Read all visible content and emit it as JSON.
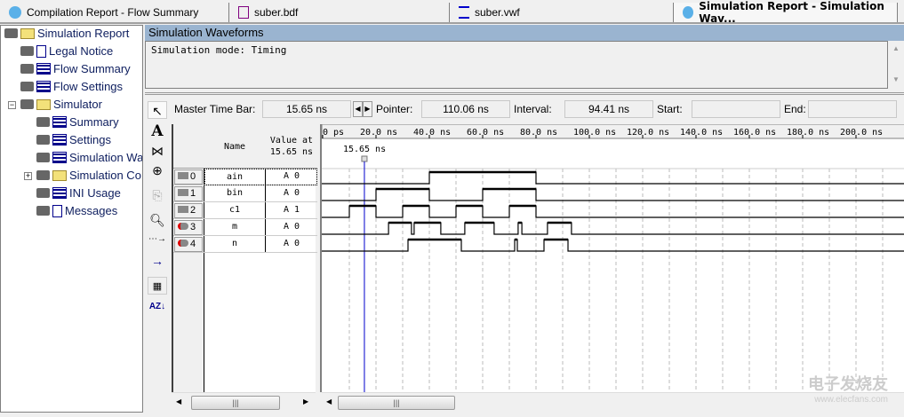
{
  "tabs": [
    {
      "label": "Compilation Report - Flow Summary",
      "icon": "report-icon",
      "active": false
    },
    {
      "label": "suber.bdf",
      "icon": "block-diagram-icon",
      "active": false
    },
    {
      "label": "suber.vwf",
      "icon": "waveform-file-icon",
      "active": false
    },
    {
      "label": "Simulation Report - Simulation Wav...",
      "icon": "report-icon",
      "active": true
    }
  ],
  "tree": [
    {
      "label": "Simulation Report",
      "icon": "folder-icon",
      "level": 0
    },
    {
      "label": "Legal Notice",
      "icon": "document-icon",
      "level": 1
    },
    {
      "label": "Flow Summary",
      "icon": "table-icon",
      "level": 1
    },
    {
      "label": "Flow Settings",
      "icon": "table-icon",
      "level": 1
    },
    {
      "label": "Simulator",
      "icon": "folder-icon",
      "level": 1,
      "expanded": true
    },
    {
      "label": "Summary",
      "icon": "table-icon",
      "level": 2
    },
    {
      "label": "Settings",
      "icon": "table-icon",
      "level": 2
    },
    {
      "label": "Simulation Wa",
      "icon": "waveform-icon",
      "level": 2
    },
    {
      "label": "Simulation Co",
      "icon": "folder-icon",
      "level": 2,
      "collapsed": true
    },
    {
      "label": "INI Usage",
      "icon": "table-icon",
      "level": 2
    },
    {
      "label": "Messages",
      "icon": "info-icon",
      "level": 2
    }
  ],
  "panel": {
    "title": "Simulation Waveforms",
    "mode_text": "Simulation mode: Timing"
  },
  "timebar": {
    "master_label": "Master Time Bar:",
    "master_value": "15.65 ns",
    "pointer_label": "Pointer:",
    "pointer_value": "110.06 ns",
    "interval_label": "Interval:",
    "interval_value": "94.41 ns",
    "start_label": "Start:",
    "start_value": "",
    "end_label": "End:",
    "end_value": ""
  },
  "table": {
    "name_header": "Name",
    "value_header": "Value at\n15.65 ns",
    "rows": [
      {
        "index": "0",
        "name": "ain",
        "value": "A 0",
        "dir": "input"
      },
      {
        "index": "1",
        "name": "bin",
        "value": "A 0",
        "dir": "input"
      },
      {
        "index": "2",
        "name": "c1",
        "value": "A 1",
        "dir": "input"
      },
      {
        "index": "3",
        "name": "m",
        "value": "A 0",
        "dir": "output"
      },
      {
        "index": "4",
        "name": "n",
        "value": "A 0",
        "dir": "output"
      }
    ]
  },
  "chart_data": {
    "type": "line",
    "time_unit": "ns",
    "xlim": [
      0,
      218
    ],
    "tick_labels": [
      "0 ps",
      "20.0 ns",
      "40.0 ns",
      "60.0 ns",
      "80.0 ns",
      "100.0 ns",
      "120.0 ns",
      "140.0 ns",
      "160.0 ns",
      "180.0 ns",
      "200.0 ns"
    ],
    "master_time_ns": 15.65,
    "master_label": "15.65 ns",
    "grid": true,
    "series": [
      {
        "name": "ain",
        "high": [
          [
            40,
            80
          ]
        ]
      },
      {
        "name": "bin",
        "high": [
          [
            20,
            40
          ],
          [
            60,
            80
          ]
        ]
      },
      {
        "name": "c1",
        "high": [
          [
            10,
            20
          ],
          [
            30,
            40
          ],
          [
            50,
            60
          ],
          [
            70,
            80
          ]
        ]
      },
      {
        "name": "m",
        "high": [
          [
            24.7,
            33.3
          ],
          [
            34.3,
            44.3
          ],
          [
            53.3,
            64.3
          ],
          [
            73.3,
            74.7
          ],
          [
            84.3,
            93.3
          ]
        ]
      },
      {
        "name": "n",
        "high": [
          [
            32,
            52
          ],
          [
            72,
            73
          ],
          [
            83,
            92
          ]
        ]
      }
    ]
  },
  "watermark": {
    "text": "电子发烧友",
    "url": "www.elecfans.com"
  }
}
